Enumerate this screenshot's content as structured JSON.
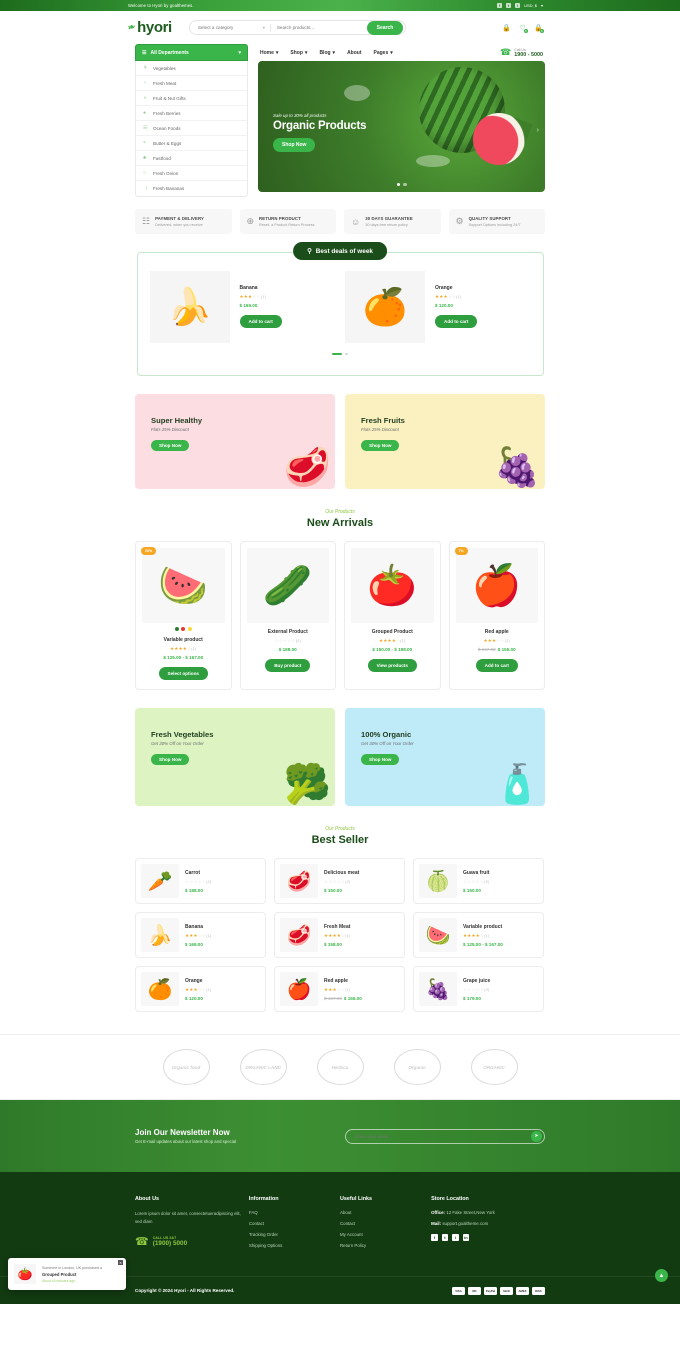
{
  "topbar": {
    "message": "Welcome to Hyori by goalthemes.",
    "social": [
      "f",
      "t",
      "i"
    ],
    "currency": "USD, $",
    "caret": "▾"
  },
  "header": {
    "logo": "hyori",
    "leaf_icon": "❧",
    "category_select": "Select a category",
    "search_placeholder": "Search products...",
    "search_button": "Search",
    "icons": [
      {
        "name": "user-icon",
        "glyph": "⚱",
        "badge": ""
      },
      {
        "name": "wishlist-icon",
        "glyph": "♡",
        "badge": "0"
      },
      {
        "name": "cart-icon",
        "glyph": "⚲",
        "badge": "0"
      }
    ]
  },
  "nav": {
    "departments_label": "All Departments",
    "menu_icon": "☰",
    "caret": "▾",
    "items": [
      "Home",
      "Shop",
      "Blog",
      "About",
      "Pages"
    ],
    "items_caret": [
      true,
      true,
      true,
      false,
      true
    ],
    "call_label": "Call Us",
    "call_number": "1900 - 5000",
    "headset_icon": "☎"
  },
  "sidebar": {
    "items": [
      {
        "label": "Vegetables",
        "icon": "⚘"
      },
      {
        "label": "Fresh Meat",
        "icon": "◔"
      },
      {
        "label": "Fruit & Nut Gifts",
        "icon": "◑"
      },
      {
        "label": "Fresh Berries",
        "icon": "●"
      },
      {
        "label": "Ocean Foods",
        "icon": "☵"
      },
      {
        "label": "Butter & Eggs",
        "icon": "◓"
      },
      {
        "label": "Fastfood",
        "icon": "♣"
      },
      {
        "label": "Fresh Onion",
        "icon": "○"
      },
      {
        "label": "Fresh Bananas",
        "icon": "☽"
      }
    ]
  },
  "hero": {
    "subtitle": "Sale up to 30% all products",
    "title": "Organic Products",
    "button": "Shop Now",
    "dots": 2,
    "active_dot": 0,
    "arrow": "›"
  },
  "features": [
    {
      "title": "PAYMENT & DELIVERY",
      "subtitle": "Delivered, when you receive",
      "icon": "☷"
    },
    {
      "title": "RETURN PRODUCT",
      "subtitle": "Reset, a Product Return Process",
      "icon": "⊕"
    },
    {
      "title": "30 DAYS GUARANTEE",
      "subtitle": "30 days free return policy",
      "icon": "☺"
    },
    {
      "title": "QUALITY SUPPORT",
      "subtitle": "Support Options including 24/7",
      "icon": "⚙"
    }
  ],
  "deals": {
    "tab_label": "Best deals of week",
    "tab_icon": "⚲",
    "items": [
      {
        "name": "Banana",
        "art": "🍌",
        "stars": 3,
        "reviews": "(1)",
        "price": "$ 169.00",
        "button": "Add to cart"
      },
      {
        "name": "Orange",
        "art": "🍊",
        "stars": 3,
        "reviews": "(1)",
        "price": "$ 120.00",
        "button": "Add to cart"
      }
    ]
  },
  "promos_top": [
    {
      "title": "Super Healthy",
      "subtitle": "Flats 25% Discount",
      "button": "Shop Now",
      "art": "🥩",
      "theme": "pink"
    },
    {
      "title": "Fresh Fruits",
      "subtitle": "Flats 25% Discount",
      "button": "Shop Now",
      "art": "🍇",
      "theme": "cream"
    }
  ],
  "new_arrivals": {
    "eyebrow": "Our Products",
    "title": "New Arrivals",
    "items": [
      {
        "name": "Variable product",
        "art": "🍉",
        "badge": "20%",
        "stars": 4,
        "reviews": "(1)",
        "price": "$ 125.00 - $ 167.00",
        "old_price": "",
        "button": "Select options",
        "swatches": [
          "#2e7d32",
          "#e53935",
          "#fdd835"
        ]
      },
      {
        "name": "External Product",
        "art": "🥒",
        "badge": "",
        "stars": 0,
        "reviews": "(0)",
        "price": "$ 188.00",
        "old_price": "",
        "button": "Buy product",
        "swatches": []
      },
      {
        "name": "Grouped Product",
        "art": "🍅",
        "badge": "",
        "stars": 4,
        "reviews": "(1)",
        "price": "$ 150.00 - $ 188.00",
        "old_price": "",
        "button": "View products",
        "swatches": []
      },
      {
        "name": "Red apple",
        "art": "🍎",
        "badge": "7%",
        "stars": 3,
        "reviews": "(1)",
        "price": "$ 155.00",
        "old_price": "$ 167.00",
        "button": "Add to cart",
        "swatches": []
      }
    ]
  },
  "promos_mid": [
    {
      "title": "Fresh Vegetables",
      "subtitle": "Get 30% Off on Your Order",
      "button": "Shop Now",
      "art": "🥦",
      "theme": "mint"
    },
    {
      "title": "100% Organic",
      "subtitle": "Get 30% Off on Your Order",
      "button": "Shop Now",
      "art": "🧴",
      "theme": "sky"
    }
  ],
  "best_seller": {
    "eyebrow": "Our Products",
    "title": "Best Seller",
    "items": [
      {
        "name": "Carrot",
        "art": "🥕",
        "stars": 0,
        "reviews": "(0)",
        "price": "$ 188.00",
        "old_price": ""
      },
      {
        "name": "Delicious meat",
        "art": "🥩",
        "stars": 0,
        "reviews": "(0)",
        "price": "$ 150.00",
        "old_price": ""
      },
      {
        "name": "Guava fruit",
        "art": "🍈",
        "stars": 0,
        "reviews": "(0)",
        "price": "$ 150.00",
        "old_price": ""
      },
      {
        "name": "Banana",
        "art": "🍌",
        "stars": 3,
        "reviews": "(1)",
        "price": "$ 169.00",
        "old_price": ""
      },
      {
        "name": "Fresh Meat",
        "art": "🥩",
        "stars": 4,
        "reviews": "(1)",
        "price": "$ 158.00",
        "old_price": ""
      },
      {
        "name": "Variable product",
        "art": "🍉",
        "stars": 4,
        "reviews": "(1)",
        "price": "$ 125.00 - $ 167.00",
        "old_price": ""
      },
      {
        "name": "Orange",
        "art": "🍊",
        "stars": 3,
        "reviews": "(1)",
        "price": "$ 120.00",
        "old_price": ""
      },
      {
        "name": "Red apple",
        "art": "🍎",
        "stars": 3,
        "reviews": "(1)",
        "price": "$ 155.00",
        "old_price": "$ 167.00"
      },
      {
        "name": "Grape juice",
        "art": "🍇",
        "stars": 0,
        "reviews": "(0)",
        "price": "$ 179.00",
        "old_price": ""
      }
    ]
  },
  "brands": [
    {
      "label": "Organic food"
    },
    {
      "label": "ORGANIC LAND"
    },
    {
      "label": "Herbica"
    },
    {
      "label": "Organic"
    },
    {
      "label": "ORGANIC"
    }
  ],
  "newsletter": {
    "title": "Join Our Newsletter Now",
    "subtitle": "Get E-mail updates about our latest shop and special",
    "placeholder": "Enter your email",
    "send_icon": "➤"
  },
  "footer": {
    "about": {
      "heading": "About Us",
      "text": "Lorem ipsum dolor sit amet, consectetueradipiscing elit, sed diam",
      "call_label": "CALL US 24/7",
      "call_number": "(1900) 5000",
      "headset_icon": "☎"
    },
    "information": {
      "heading": "Information",
      "links": [
        "FAQ",
        "Contact",
        "Tracking Order",
        "Shipping Options"
      ]
    },
    "useful": {
      "heading": "Useful Links",
      "links": [
        "About",
        "Contact",
        "My Account",
        "Return Policy"
      ]
    },
    "store": {
      "heading": "Store Location",
      "office_label": "Office:",
      "office_value": "12 Fake Street,New York",
      "mail_label": "Mail:",
      "mail_value": "support.goaltheme.com",
      "social": [
        "f",
        "t",
        "i",
        "in"
      ]
    },
    "copyright": "Copyright © 2024 Hyori - All Rights Reserved.",
    "payments": [
      "VISA",
      "MC",
      "PayPal",
      "Skrill",
      "AMEX",
      "DISC"
    ]
  },
  "popup": {
    "line1": "Someone in London, UK purchased a",
    "product": "Grouped Product",
    "time": "About 44 minutes ago",
    "art": "🍅",
    "close": "✕"
  },
  "to_top": "▲"
}
